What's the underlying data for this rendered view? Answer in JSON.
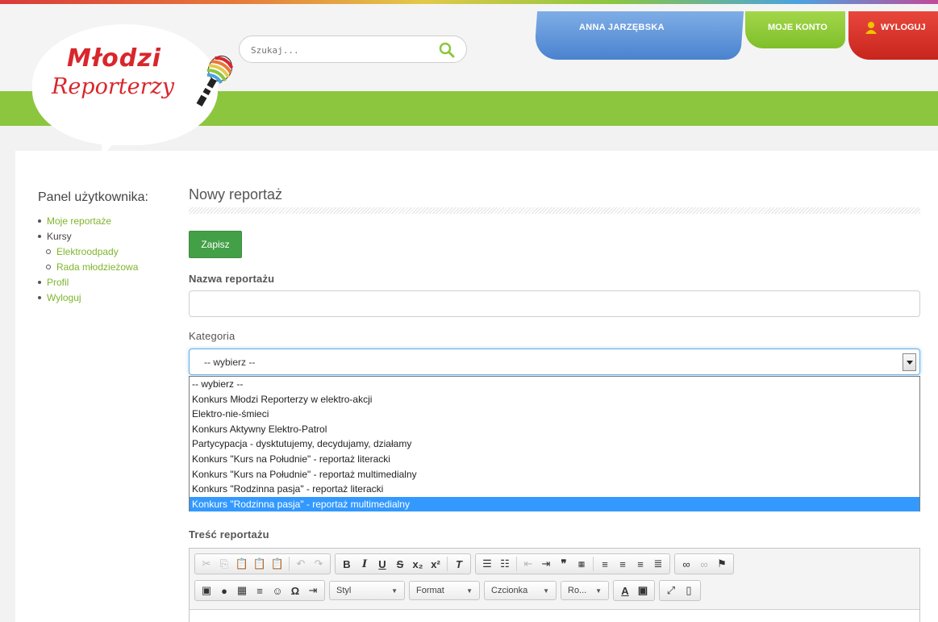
{
  "header": {
    "logo_line1": "Młodzi",
    "logo_line2": "Reporterzy",
    "search_placeholder": "Szukaj...",
    "user_name": "ANNA JARZĘBSKA",
    "account_label": "MOJE KONTO",
    "logout_label": "WYLOGUJ"
  },
  "sidebar": {
    "title": "Panel użytkownika:",
    "items": [
      {
        "label": "Moje reportaże"
      },
      {
        "label": "Kursy"
      },
      {
        "label": "Profil"
      },
      {
        "label": "Wyloguj"
      }
    ],
    "sub_items": [
      {
        "label": "Elektroodpady"
      },
      {
        "label": "Rada młodzieżowa"
      }
    ]
  },
  "main": {
    "title": "Nowy reportaż",
    "save_label": "Zapisz",
    "name_label": "Nazwa reportażu",
    "name_value": "",
    "category_label": "Kategoria",
    "category_selected": "-- wybierz --",
    "category_options": [
      "-- wybierz --",
      "Konkurs Młodzi Reporterzy w elektro-akcji",
      "Elektro-nie-śmieci",
      "Konkurs Aktywny Elektro-Patrol",
      "Partycypacja - dysktutujemy, decydujamy, działamy",
      "Konkurs \"Kurs na Południe\" - reportaż literacki",
      "Konkurs \"Kurs na Południe\" - reportaż multimedialny",
      "Konkurs \"Rodzinna pasja\" - reportaż literacki",
      "Konkurs \"Rodzinna pasja\" - reportaż multimedialny"
    ],
    "highlighted_option_index": 8,
    "content_label": "Treść reportażu"
  },
  "editor": {
    "combos": {
      "style": "Styl",
      "format": "Format",
      "font": "Czcionka",
      "size": "Ro..."
    }
  },
  "colors": {
    "brand_green": "#8cc63f",
    "brand_red": "#d9262c",
    "brand_blue": "#4a82cf",
    "save_green": "#43a047",
    "highlight": "#3399ff"
  }
}
